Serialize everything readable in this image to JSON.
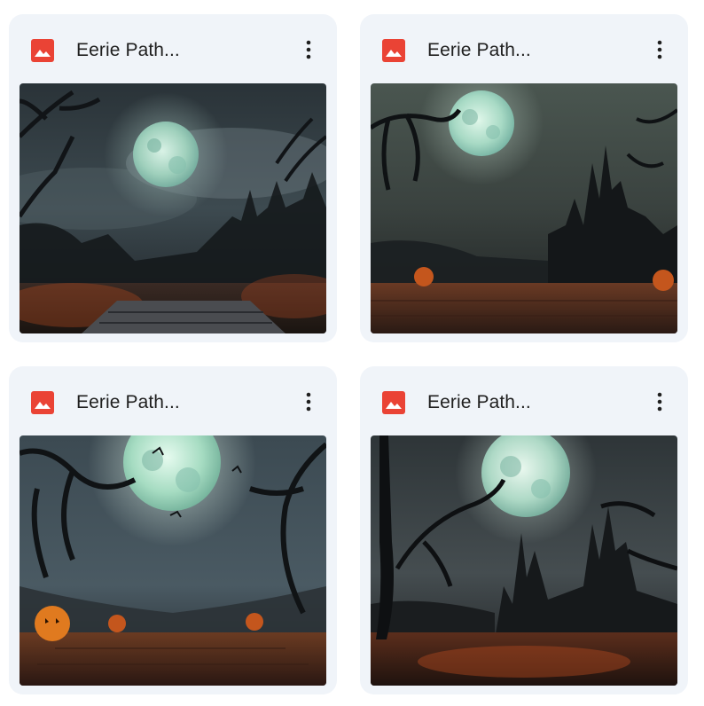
{
  "files": [
    {
      "title": "Eerie Path...",
      "icon": "image-icon",
      "menu_icon": "more-vert-icon"
    },
    {
      "title": "Eerie Path...",
      "icon": "image-icon",
      "menu_icon": "more-vert-icon"
    },
    {
      "title": "Eerie Path...",
      "icon": "image-icon",
      "menu_icon": "more-vert-icon"
    },
    {
      "title": "Eerie Path...",
      "icon": "image-icon",
      "menu_icon": "more-vert-icon"
    }
  ],
  "colors": {
    "card_bg": "#f0f4f9",
    "image_icon": "#ea4335",
    "title_text": "#1f1f1f"
  }
}
